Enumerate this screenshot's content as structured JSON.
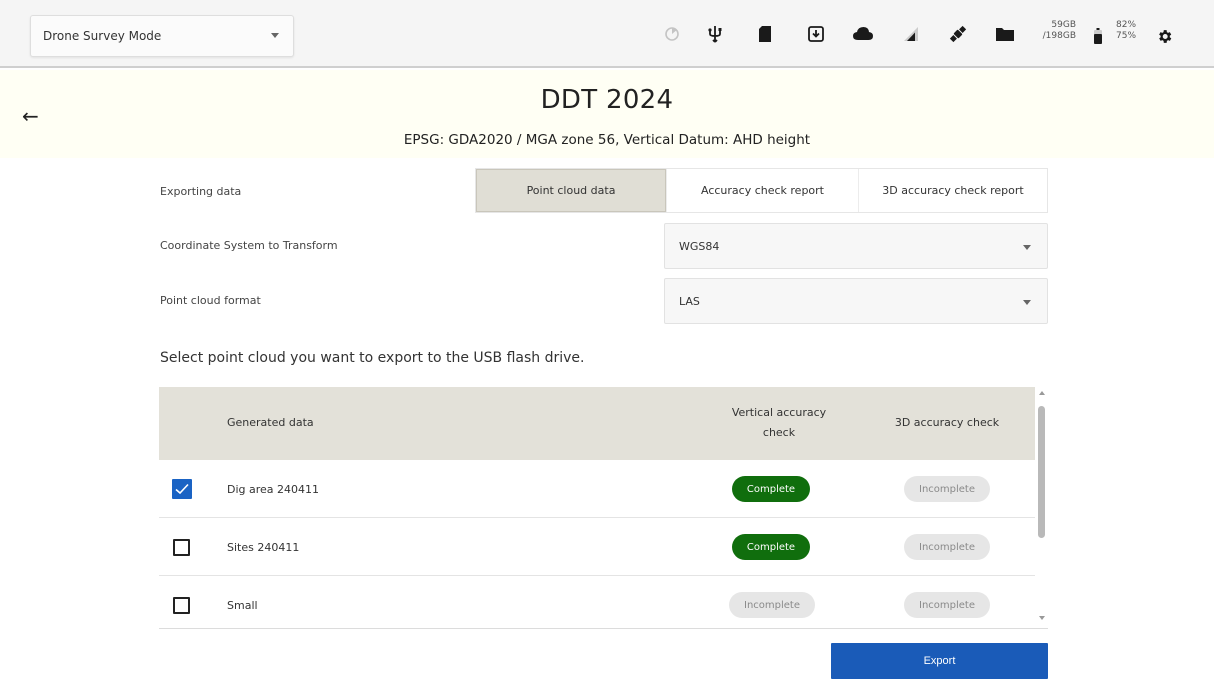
{
  "topbar": {
    "mode": "Drone Survey Mode",
    "icons": [
      "loading-progress-icon",
      "usb-icon",
      "sd-card-icon",
      "download-icon",
      "cloud-icon",
      "signal-icon",
      "satellite-icon",
      "folder-icon",
      "battery-icon",
      "gear-icon"
    ],
    "storage_used": "59GB",
    "storage_total": "/198GB",
    "battery_primary": "82%",
    "battery_secondary": "75%"
  },
  "header": {
    "title": "DDT 2024",
    "subtitle": "EPSG: GDA2020 / MGA zone 56, Vertical Datum: AHD height"
  },
  "form": {
    "exporting_label": "Exporting data",
    "tabs": [
      "Point cloud data",
      "Accuracy check report",
      "3D accuracy check report"
    ],
    "active_tab": "Point cloud data",
    "coord_label": "Coordinate System to Transform",
    "coord_value": "WGS84",
    "format_label": "Point cloud format",
    "format_value": "LAS"
  },
  "instruction": "Select point cloud you want to export to the USB flash drive.",
  "table": {
    "headers": {
      "generated": "Generated data",
      "vertical_line1": "Vertical accuracy",
      "vertical_line2": "check",
      "accuracy3d": "3D accuracy check"
    },
    "rows": [
      {
        "name": "Dig area 240411",
        "checked": true,
        "vertical": "Complete",
        "acc3d": "Incomplete"
      },
      {
        "name": "Sites 240411",
        "checked": false,
        "vertical": "Complete",
        "acc3d": "Incomplete"
      },
      {
        "name": "Small",
        "checked": false,
        "vertical": "Incomplete",
        "acc3d": "Incomplete"
      }
    ]
  },
  "export_label": "Export",
  "colors": {
    "complete": "#106e0d",
    "incomplete": "#e6e6e6",
    "accent": "#1a5bb8",
    "header_bg": "#fffff4",
    "table_header_bg": "#e3e1d9"
  }
}
